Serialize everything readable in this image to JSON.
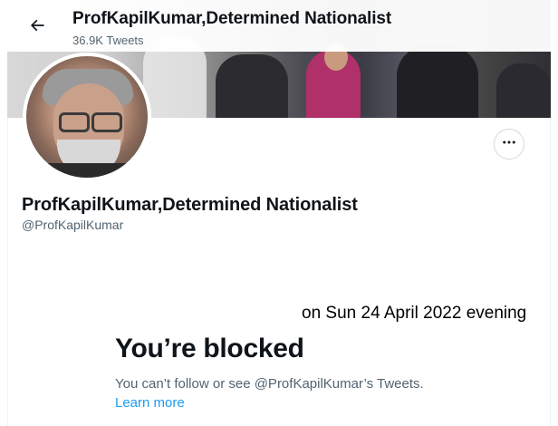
{
  "header": {
    "back_icon": "arrow-left-icon",
    "name": "ProfKapilKumar,Determined Nationalist",
    "tweet_count": "36.9K Tweets"
  },
  "profile": {
    "display_name": "ProfKapilKumar,Determined Nationalist",
    "handle": "@ProfKapilKumar",
    "more_icon": "more-horizontal-icon"
  },
  "annotation": {
    "text": "on Sun 24 April 2022 evening"
  },
  "blocked": {
    "title": "You’re blocked",
    "description": "You can’t follow or see @ProfKapilKumar’s Tweets.",
    "learn_more": "Learn more"
  },
  "colors": {
    "link": "#1d9bf0",
    "secondary_text": "#536471",
    "primary_text": "#0f1419"
  }
}
